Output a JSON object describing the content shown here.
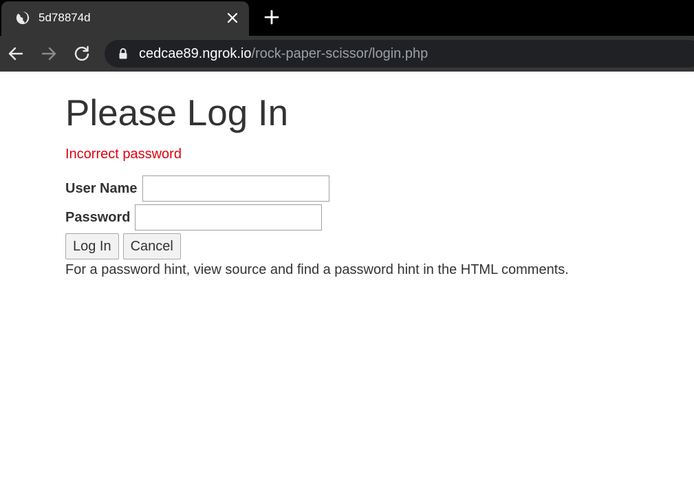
{
  "browser": {
    "tab": {
      "title": "5d78874d",
      "favicon": "globe-icon"
    },
    "new_tab_icon": "plus-icon",
    "close_tab_icon": "close-icon",
    "nav": {
      "back_icon": "back-arrow-icon",
      "forward_icon": "forward-arrow-icon",
      "reload_icon": "reload-icon"
    },
    "address_bar": {
      "host": "cedcae89.ngrok.io",
      "path": "/rock-paper-scissor/login.php",
      "secure_icon": "lock-icon"
    }
  },
  "page": {
    "title": "Please Log In",
    "error": "Incorrect password",
    "form": {
      "username_label": "User Name",
      "username_value": "",
      "password_label": "Password",
      "password_value": "",
      "login_button": "Log In",
      "cancel_button": "Cancel"
    },
    "hint": "For a password hint, view source and find a password hint in the HTML comments."
  },
  "colors": {
    "error": "#e0000f",
    "text": "#333333",
    "chrome_dark": "#353535"
  }
}
